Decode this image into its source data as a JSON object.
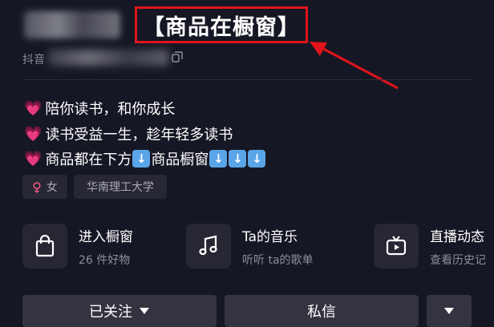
{
  "header": {
    "highlight_title": "【商品在橱窗】",
    "douyin_prefix": "抖音"
  },
  "bio": {
    "lines": [
      {
        "text": "陪你读书，和你成长"
      },
      {
        "text": "读书受益一生，趁年轻多读书"
      },
      {
        "text_a": "商品都在下方",
        "text_b": "商品橱窗"
      }
    ],
    "heart_icon": "heart-emoji",
    "arrow_icon": "down-arrow-emoji",
    "arrow_glyph": "↓"
  },
  "tags": [
    {
      "label": "女",
      "icon": "female-symbol-icon"
    },
    {
      "label": "华南理工大学"
    }
  ],
  "features": [
    {
      "title": "进入橱窗",
      "subtitle": "26 件好物",
      "icon": "shopping-bag-icon"
    },
    {
      "title": "Ta的音乐",
      "subtitle": "听听 ta的歌单",
      "icon": "music-note-icon"
    },
    {
      "title": "直播动态",
      "subtitle": "查看历史记",
      "icon": "tv-play-icon"
    }
  ],
  "actions": {
    "followed_label": "已关注",
    "message_label": "私信"
  },
  "colors": {
    "background": "#161724",
    "highlight_border": "#e0141b",
    "heart": "#ff6bb5",
    "arrow_emoji_bg": "#5aa5e8",
    "button_bg": "#33343f"
  }
}
